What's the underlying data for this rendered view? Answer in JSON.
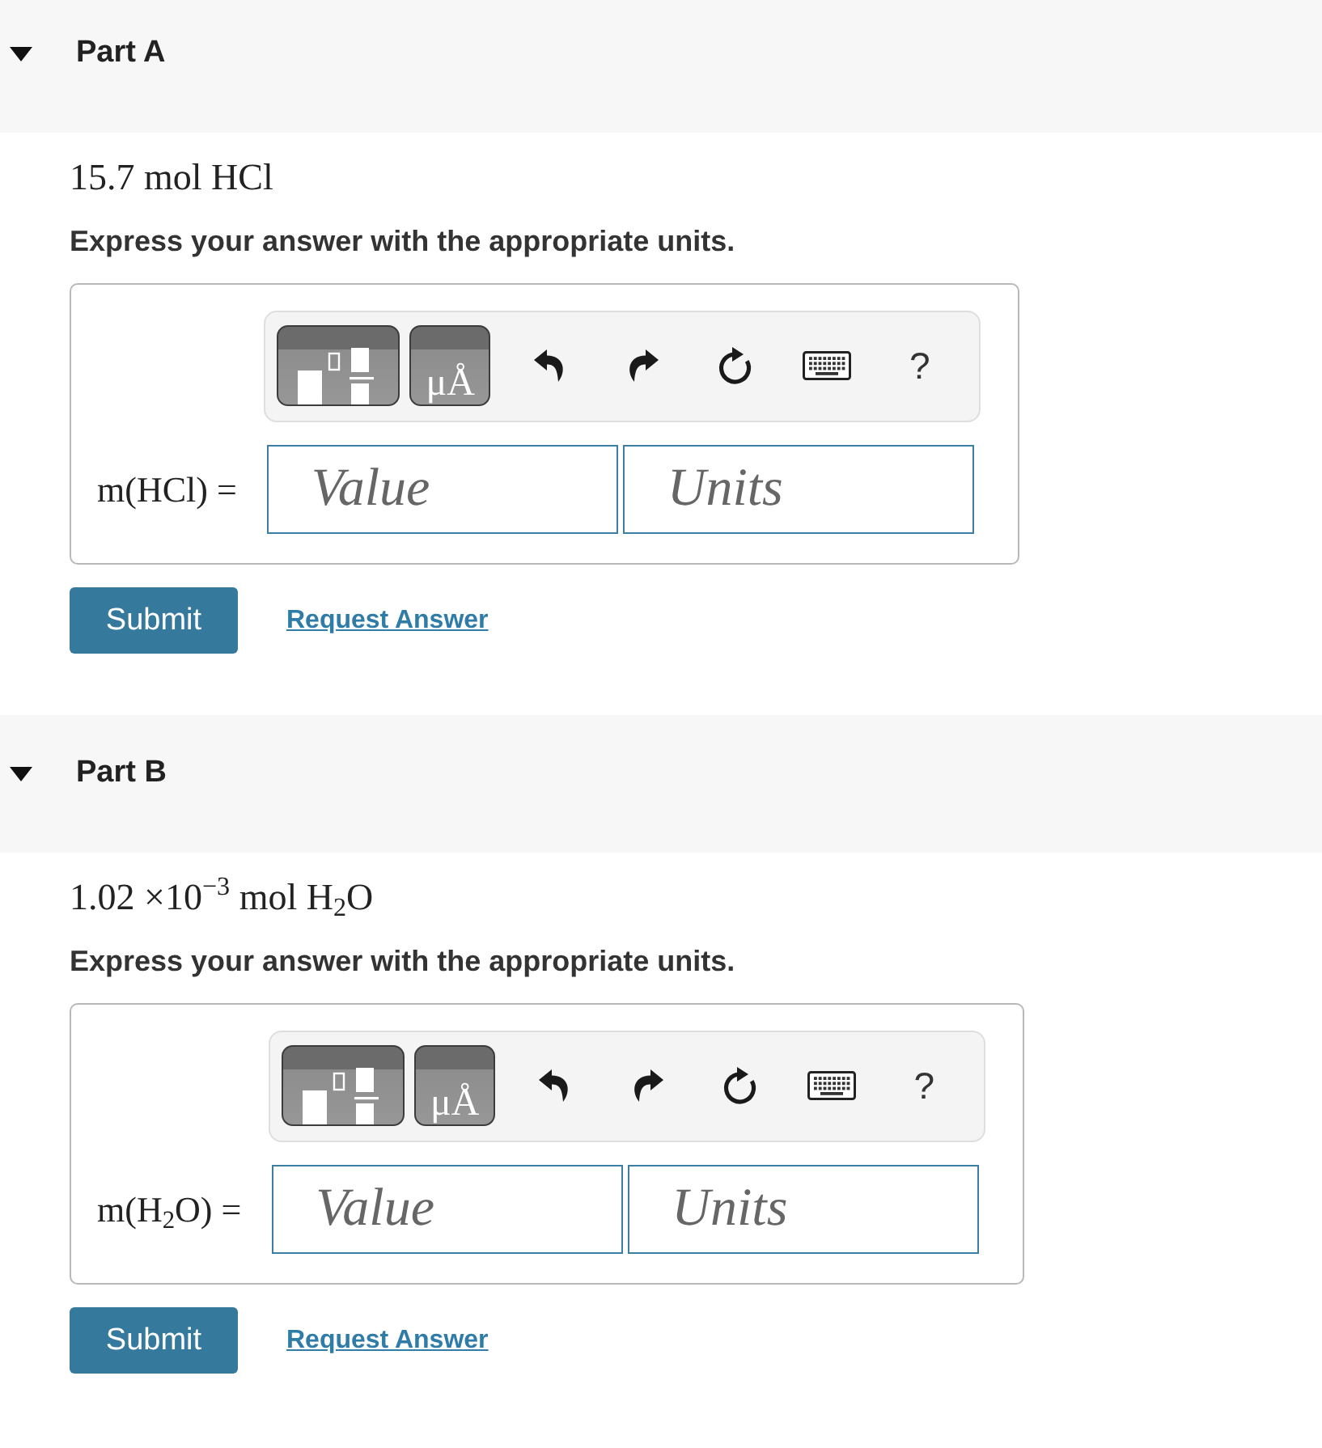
{
  "parts": [
    {
      "title": "Part A",
      "expanded": true,
      "quantity": "15.7 mol HCl",
      "instruction": "Express your answer with the appropriate units.",
      "toolbar": {
        "units_label": "μÅ",
        "help_label": "?"
      },
      "answer": {
        "label": "m(HCl) =",
        "value_field": {
          "placeholder": "Value"
        },
        "units_field": {
          "placeholder": "Units"
        }
      },
      "submit_button": "Submit",
      "request_answer_link": "Request Answer"
    },
    {
      "title": "Part B",
      "expanded": true,
      "quantity": "1.02 ×10$^{−3}$ mol H$_{2}$O",
      "instruction": "Express your answer with the appropriate units.",
      "toolbar": {
        "units_label": "μÅ",
        "help_label": "?"
      },
      "answer": {
        "label": "m(H$_{2}$O) =",
        "value_field": {
          "placeholder": "Value"
        },
        "units_field": {
          "placeholder": "Units"
        }
      },
      "submit_button": "Submit",
      "request_answer_link": "Request Answer"
    }
  ]
}
